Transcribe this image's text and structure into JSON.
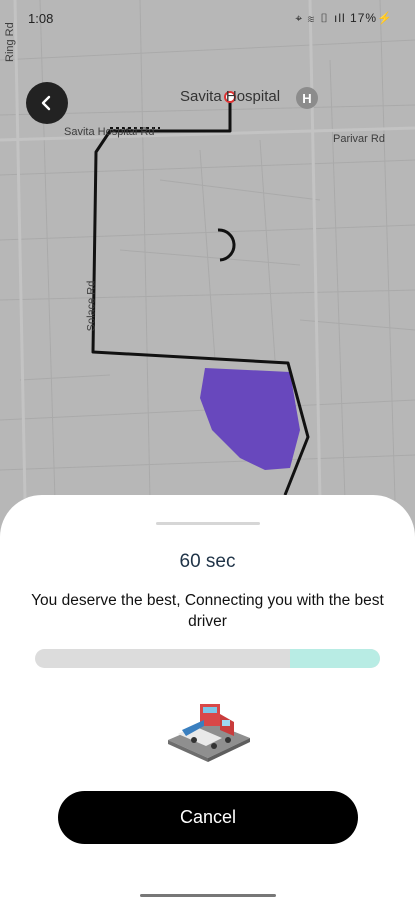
{
  "status_bar": {
    "time": "1:08",
    "icons": "⌖ ≋ ▯ ıll 17%⚡"
  },
  "map": {
    "labels": {
      "hospital": "Savita Hospital",
      "hospital_rd": "Savita Hospital Rd",
      "parivar_rd": "Parivar Rd",
      "ring_rd": "Ring Rd",
      "solace_rd": "Solace Rd"
    },
    "hospital_icon": "H",
    "route_color": "#111111",
    "area_color": "#6848bd"
  },
  "sheet": {
    "timer": "60 sec",
    "message": "You deserve the best, Connecting you with the best driver",
    "progress": {
      "remaining_fraction": 0.26,
      "fill_color": "#b8ece4",
      "track_color": "#dcdcdc"
    },
    "illustration_icon": "tow-truck-illustration",
    "cancel_label": "Cancel"
  }
}
